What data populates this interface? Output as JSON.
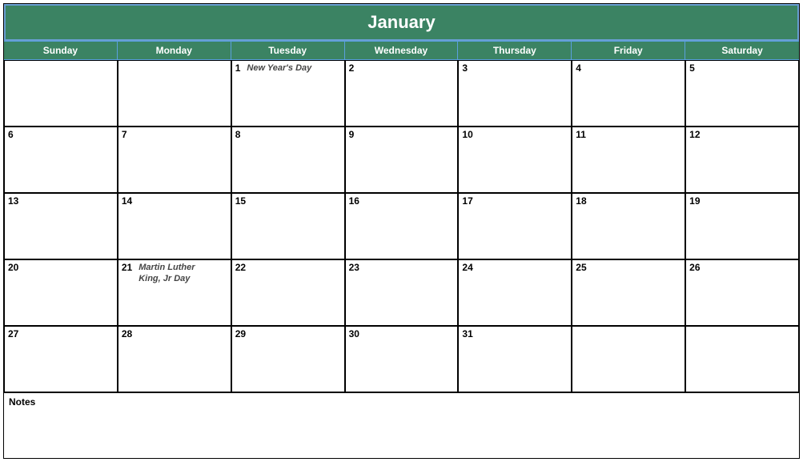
{
  "title": "January",
  "weekdays": [
    "Sunday",
    "Monday",
    "Tuesday",
    "Wednesday",
    "Thursday",
    "Friday",
    "Saturday"
  ],
  "weeks": [
    [
      {
        "day": "",
        "event": ""
      },
      {
        "day": "",
        "event": ""
      },
      {
        "day": "1",
        "event": "New Year's Day"
      },
      {
        "day": "2",
        "event": ""
      },
      {
        "day": "3",
        "event": ""
      },
      {
        "day": "4",
        "event": ""
      },
      {
        "day": "5",
        "event": ""
      }
    ],
    [
      {
        "day": "6",
        "event": ""
      },
      {
        "day": "7",
        "event": ""
      },
      {
        "day": "8",
        "event": ""
      },
      {
        "day": "9",
        "event": ""
      },
      {
        "day": "10",
        "event": ""
      },
      {
        "day": "11",
        "event": ""
      },
      {
        "day": "12",
        "event": ""
      }
    ],
    [
      {
        "day": "13",
        "event": ""
      },
      {
        "day": "14",
        "event": ""
      },
      {
        "day": "15",
        "event": ""
      },
      {
        "day": "16",
        "event": ""
      },
      {
        "day": "17",
        "event": ""
      },
      {
        "day": "18",
        "event": ""
      },
      {
        "day": "19",
        "event": ""
      }
    ],
    [
      {
        "day": "20",
        "event": ""
      },
      {
        "day": "21",
        "event": "Martin Luther King, Jr Day"
      },
      {
        "day": "22",
        "event": ""
      },
      {
        "day": "23",
        "event": ""
      },
      {
        "day": "24",
        "event": ""
      },
      {
        "day": "25",
        "event": ""
      },
      {
        "day": "26",
        "event": ""
      }
    ],
    [
      {
        "day": "27",
        "event": ""
      },
      {
        "day": "28",
        "event": ""
      },
      {
        "day": "29",
        "event": ""
      },
      {
        "day": "30",
        "event": ""
      },
      {
        "day": "31",
        "event": ""
      },
      {
        "day": "",
        "event": ""
      },
      {
        "day": "",
        "event": ""
      }
    ]
  ],
  "notes_label": "Notes"
}
